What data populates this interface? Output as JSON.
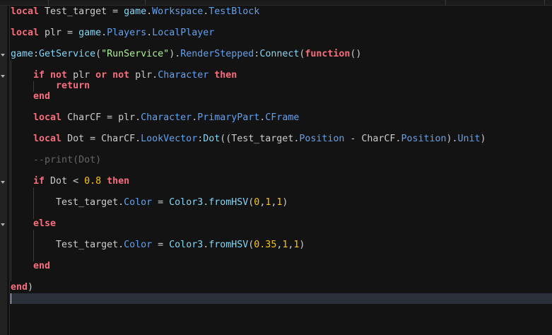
{
  "colors": {
    "keyword": "#f86d7c",
    "text": "#cccccc",
    "property": "#61a1f1",
    "builtin": "#84d6f7",
    "string": "#adf195",
    "number": "#ffc600",
    "comment": "#666666"
  },
  "lines": [
    {
      "row": 0,
      "tokens": [
        [
          "kw",
          "local"
        ],
        [
          "txt",
          " Test_target = "
        ],
        [
          "fn",
          "game"
        ],
        [
          "txt",
          "."
        ],
        [
          "prop",
          "Workspace"
        ],
        [
          "txt",
          "."
        ],
        [
          "prop",
          "TestBlock"
        ]
      ]
    },
    {
      "row": 2,
      "tokens": [
        [
          "kw",
          "local"
        ],
        [
          "txt",
          " plr = "
        ],
        [
          "fn",
          "game"
        ],
        [
          "txt",
          "."
        ],
        [
          "prop",
          "Players"
        ],
        [
          "txt",
          "."
        ],
        [
          "prop",
          "LocalPlayer"
        ]
      ]
    },
    {
      "row": 4,
      "tokens": [
        [
          "fn",
          "game"
        ],
        [
          "txt",
          ":"
        ],
        [
          "fn",
          "GetService"
        ],
        [
          "txt",
          "("
        ],
        [
          "str",
          "\"RunService\""
        ],
        [
          "txt",
          ")."
        ],
        [
          "prop",
          "RenderStepped"
        ],
        [
          "txt",
          ":"
        ],
        [
          "fn",
          "Connect"
        ],
        [
          "txt",
          "("
        ],
        [
          "kw",
          "function"
        ],
        [
          "txt",
          "()"
        ]
      ]
    },
    {
      "row": 6,
      "tokens": [
        [
          "txt",
          "    "
        ],
        [
          "kw",
          "if not"
        ],
        [
          "txt",
          " plr "
        ],
        [
          "kw",
          "or not"
        ],
        [
          "txt",
          " plr."
        ],
        [
          "prop",
          "Character"
        ],
        [
          "txt",
          " "
        ],
        [
          "kw",
          "then"
        ]
      ]
    },
    {
      "row": 7,
      "tokens": [
        [
          "txt",
          "        "
        ],
        [
          "kw",
          "return"
        ]
      ]
    },
    {
      "row": 8,
      "tokens": [
        [
          "txt",
          "    "
        ],
        [
          "kw",
          "end"
        ]
      ]
    },
    {
      "row": 10,
      "tokens": [
        [
          "txt",
          "    "
        ],
        [
          "kw",
          "local"
        ],
        [
          "txt",
          " CharCF = plr."
        ],
        [
          "prop",
          "Character"
        ],
        [
          "txt",
          "."
        ],
        [
          "prop",
          "PrimaryPart"
        ],
        [
          "txt",
          "."
        ],
        [
          "prop",
          "CFrame"
        ]
      ]
    },
    {
      "row": 12,
      "tokens": [
        [
          "txt",
          "    "
        ],
        [
          "kw",
          "local"
        ],
        [
          "txt",
          " Dot = CharCF."
        ],
        [
          "prop",
          "LookVector"
        ],
        [
          "txt",
          ":"
        ],
        [
          "fn",
          "Dot"
        ],
        [
          "txt",
          "((Test_target."
        ],
        [
          "prop",
          "Position"
        ],
        [
          "txt",
          " - CharCF."
        ],
        [
          "prop",
          "Position"
        ],
        [
          "txt",
          ")."
        ],
        [
          "prop",
          "Unit"
        ],
        [
          "txt",
          ")"
        ]
      ]
    },
    {
      "row": 14,
      "tokens": [
        [
          "txt",
          "    "
        ],
        [
          "com",
          "--print(Dot)"
        ]
      ]
    },
    {
      "row": 16,
      "tokens": [
        [
          "txt",
          "    "
        ],
        [
          "kw",
          "if"
        ],
        [
          "txt",
          " Dot < "
        ],
        [
          "num",
          "0.8"
        ],
        [
          "txt",
          " "
        ],
        [
          "kw",
          "then"
        ]
      ]
    },
    {
      "row": 18,
      "tokens": [
        [
          "txt",
          "        Test_target."
        ],
        [
          "prop",
          "Color"
        ],
        [
          "txt",
          " = "
        ],
        [
          "fn",
          "Color3"
        ],
        [
          "txt",
          "."
        ],
        [
          "fn",
          "fromHSV"
        ],
        [
          "txt",
          "("
        ],
        [
          "num",
          "0"
        ],
        [
          "txt",
          ","
        ],
        [
          "num",
          "1"
        ],
        [
          "txt",
          ","
        ],
        [
          "num",
          "1"
        ],
        [
          "txt",
          ")"
        ]
      ]
    },
    {
      "row": 20,
      "tokens": [
        [
          "txt",
          "    "
        ],
        [
          "kw",
          "else"
        ]
      ]
    },
    {
      "row": 22,
      "tokens": [
        [
          "txt",
          "        Test_target."
        ],
        [
          "prop",
          "Color"
        ],
        [
          "txt",
          " = "
        ],
        [
          "fn",
          "Color3"
        ],
        [
          "txt",
          "."
        ],
        [
          "fn",
          "fromHSV"
        ],
        [
          "txt",
          "("
        ],
        [
          "num",
          "0.35"
        ],
        [
          "txt",
          ","
        ],
        [
          "num",
          "1"
        ],
        [
          "txt",
          ","
        ],
        [
          "num",
          "1"
        ],
        [
          "txt",
          ")"
        ]
      ]
    },
    {
      "row": 24,
      "tokens": [
        [
          "txt",
          "    "
        ],
        [
          "kw",
          "end"
        ]
      ]
    },
    {
      "row": 26,
      "tokens": [
        [
          "kw",
          "end"
        ],
        [
          "txt",
          ")"
        ]
      ]
    }
  ]
}
